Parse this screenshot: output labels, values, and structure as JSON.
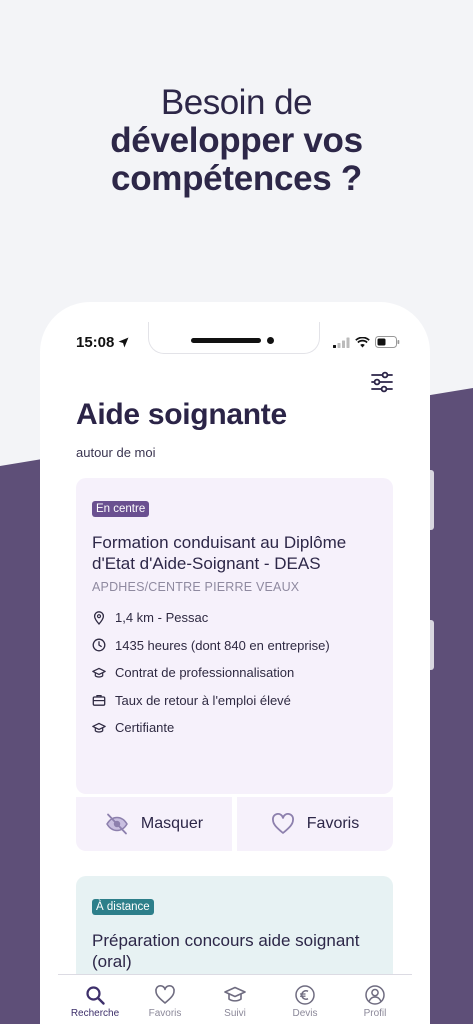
{
  "headline": {
    "line1": "Besoin de",
    "line2": "développer vos",
    "line3": "compétences ?"
  },
  "status_bar": {
    "time": "15:08"
  },
  "page": {
    "title": "Aide soignante",
    "subtitle": "autour de moi"
  },
  "results": [
    {
      "badge": "En centre",
      "title": "Formation conduisant au Diplôme d'Etat d'Aide-Soignant - DEAS",
      "organization": "APDHES/CENTRE PIERRE VEAUX",
      "features": [
        {
          "icon": "location-pin-icon",
          "text": "1,4 km - Pessac"
        },
        {
          "icon": "clock-icon",
          "text": "1435 heures (dont 840 en entreprise)"
        },
        {
          "icon": "graduation-cap-icon",
          "text": "Contrat de professionnalisation"
        },
        {
          "icon": "briefcase-icon",
          "text": "Taux de retour à l'emploi élevé"
        },
        {
          "icon": "graduation-cap-icon",
          "text": "Certifiante"
        }
      ],
      "actions": {
        "hide": "Masquer",
        "favorite": "Favoris"
      }
    },
    {
      "badge": "À distance",
      "title": "Préparation concours aide soignant (oral)"
    }
  ],
  "tabbar": [
    {
      "label": "Recherche",
      "icon": "search-icon",
      "active": true
    },
    {
      "label": "Favoris",
      "icon": "heart-icon",
      "active": false
    },
    {
      "label": "Suivi",
      "icon": "graduation-cap-icon",
      "active": false
    },
    {
      "label": "Devis",
      "icon": "euro-icon",
      "active": false
    },
    {
      "label": "Profil",
      "icon": "user-icon",
      "active": false
    }
  ],
  "colors": {
    "brand_purple": "#5e4f78",
    "card_lilac": "#f6f1fb",
    "card_teal": "#e7f2f3",
    "badge_centre": "#6a5090",
    "badge_distance": "#2d7f8a",
    "text_dark": "#2b2447"
  }
}
